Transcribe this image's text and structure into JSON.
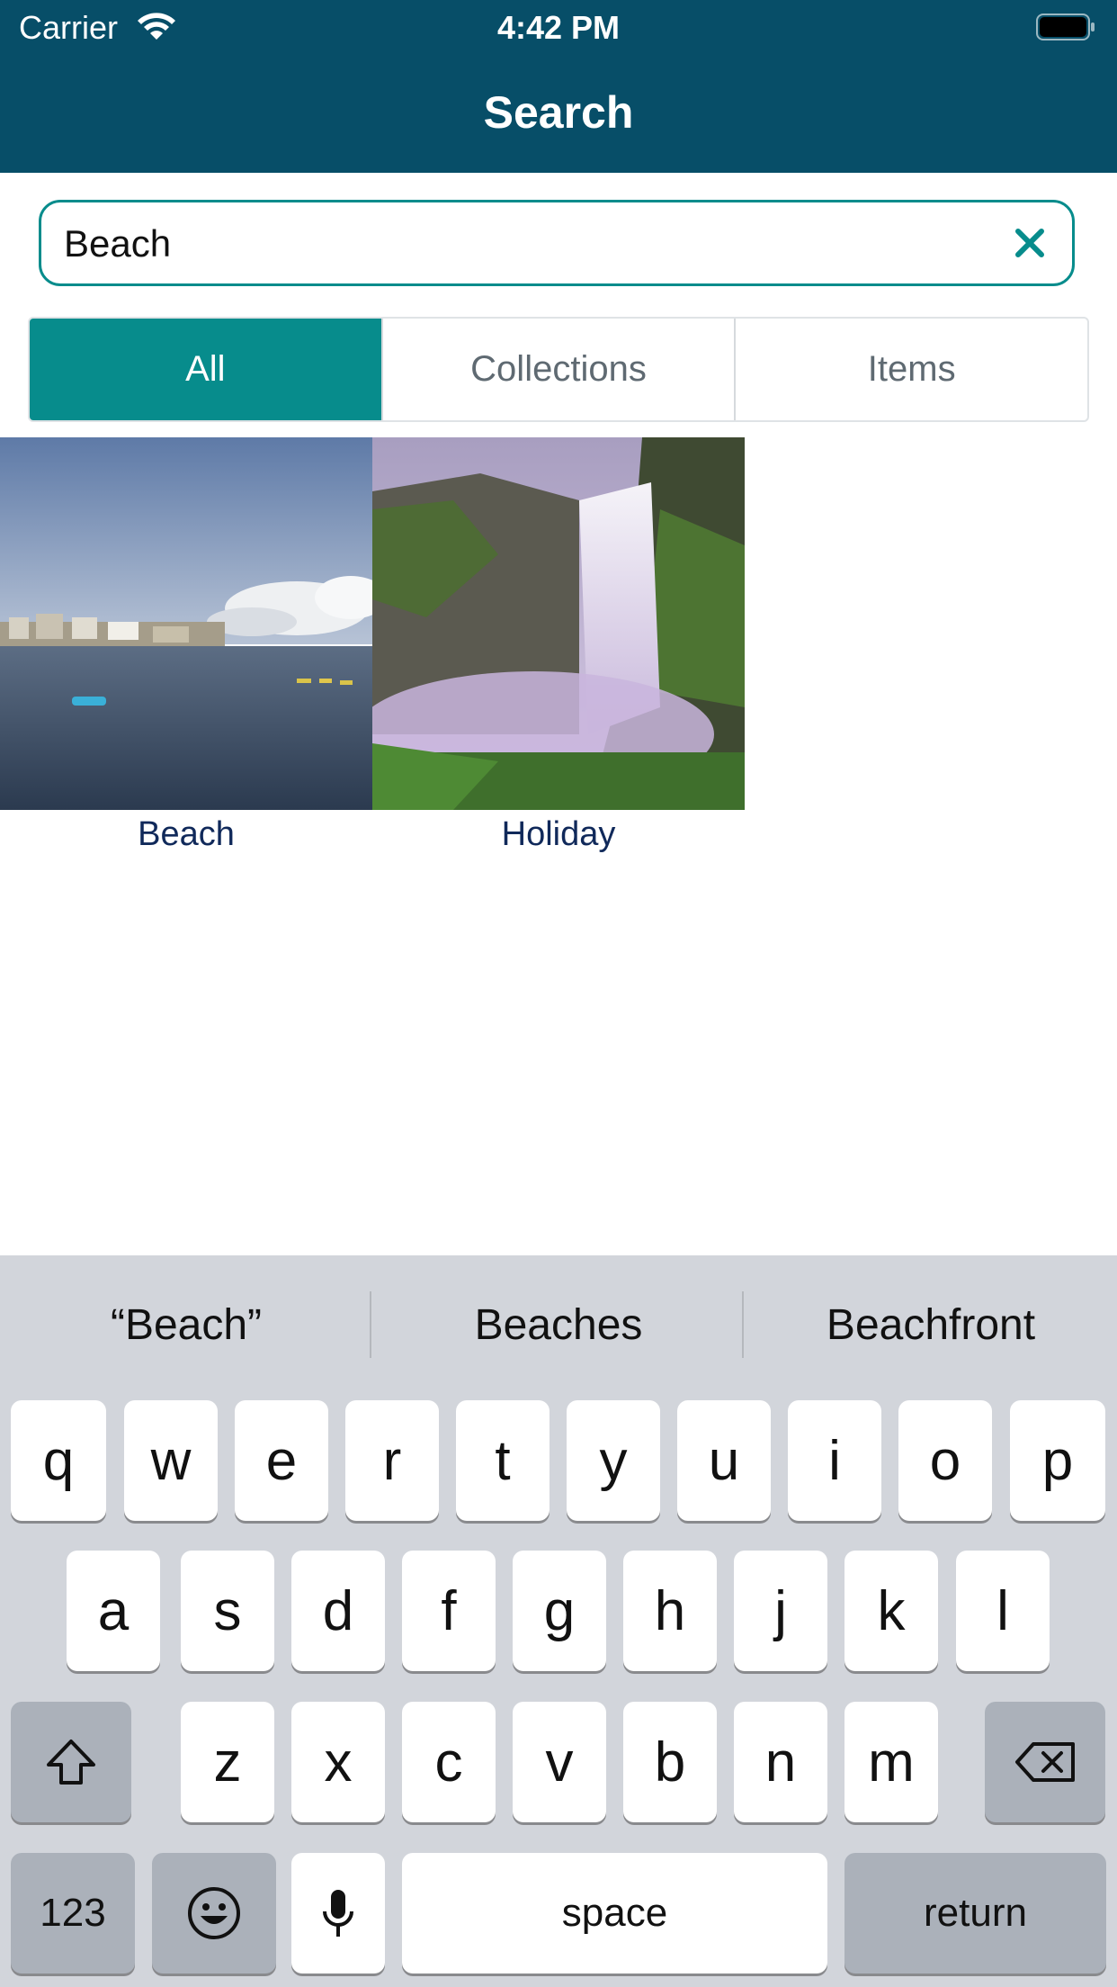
{
  "status_bar": {
    "carrier": "Carrier",
    "time": "4:42 PM"
  },
  "nav": {
    "title": "Search"
  },
  "search": {
    "value": "Beach"
  },
  "segments": {
    "all": "All",
    "collections": "Collections",
    "items": "Items"
  },
  "results": [
    {
      "label": "Beach"
    },
    {
      "label": "Holiday"
    }
  ],
  "keyboard": {
    "suggestions": [
      "“Beach”",
      "Beaches",
      "Beachfront"
    ],
    "row1": [
      "q",
      "w",
      "e",
      "r",
      "t",
      "y",
      "u",
      "i",
      "o",
      "p"
    ],
    "row2": [
      "a",
      "s",
      "d",
      "f",
      "g",
      "h",
      "j",
      "k",
      "l"
    ],
    "row3": [
      "z",
      "x",
      "c",
      "v",
      "b",
      "n",
      "m"
    ],
    "numbers_key": "123",
    "space_key": "space",
    "return_key": "return"
  },
  "colors": {
    "header": "#074e68",
    "accent": "#078c8c",
    "label": "#10295a"
  }
}
